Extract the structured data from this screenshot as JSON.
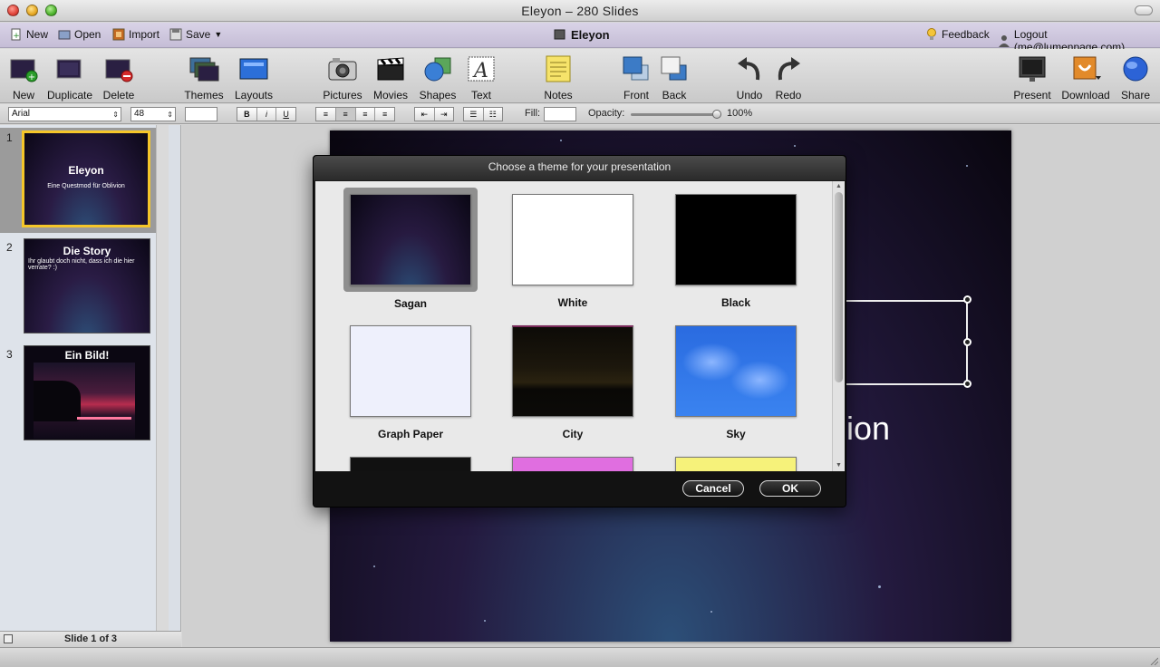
{
  "window": {
    "title": "Eleyon – 280 Slides"
  },
  "menubar": {
    "new": "New",
    "open": "Open",
    "import": "Import",
    "save": "Save",
    "doc_title": "Eleyon",
    "feedback": "Feedback",
    "logout": "Logout (me@lumenpage.com)"
  },
  "toolbar": {
    "new": "New",
    "duplicate": "Duplicate",
    "delete": "Delete",
    "themes": "Themes",
    "layouts": "Layouts",
    "pictures": "Pictures",
    "movies": "Movies",
    "shapes": "Shapes",
    "text": "Text",
    "notes": "Notes",
    "front": "Front",
    "back": "Back",
    "undo": "Undo",
    "redo": "Redo",
    "present": "Present",
    "download": "Download",
    "share": "Share"
  },
  "formatbar": {
    "font": "Arial",
    "size": "48",
    "bold": "B",
    "italic": "i",
    "underline": "U",
    "fill_label": "Fill:",
    "opacity_label": "Opacity:",
    "opacity_value": "100%",
    "opacity_fraction": 1.0
  },
  "slides": [
    {
      "num": "1",
      "title": "Eleyon",
      "subtitle": "Eine Questmod für Oblivion"
    },
    {
      "num": "2",
      "title": "Die Story",
      "subtitle": "Ihr glaubt doch nicht, dass ich die hier verrate? :)"
    },
    {
      "num": "3",
      "title": "Ein Bild!",
      "subtitle": ""
    }
  ],
  "slide_footer": "Slide 1 of 3",
  "canvas": {
    "partial_text": "ion"
  },
  "dialog": {
    "title": "Choose a theme for your presentation",
    "themes": [
      "Sagan",
      "White",
      "Black",
      "Graph Paper",
      "City",
      "Sky"
    ],
    "selected": "Sagan",
    "cancel": "Cancel",
    "ok": "OK"
  },
  "colors": {
    "selection": "#f5c629",
    "menubar": "#d0c9de",
    "theme_row3": [
      "#111111",
      "#e06ee0",
      "#f6f27a"
    ]
  }
}
